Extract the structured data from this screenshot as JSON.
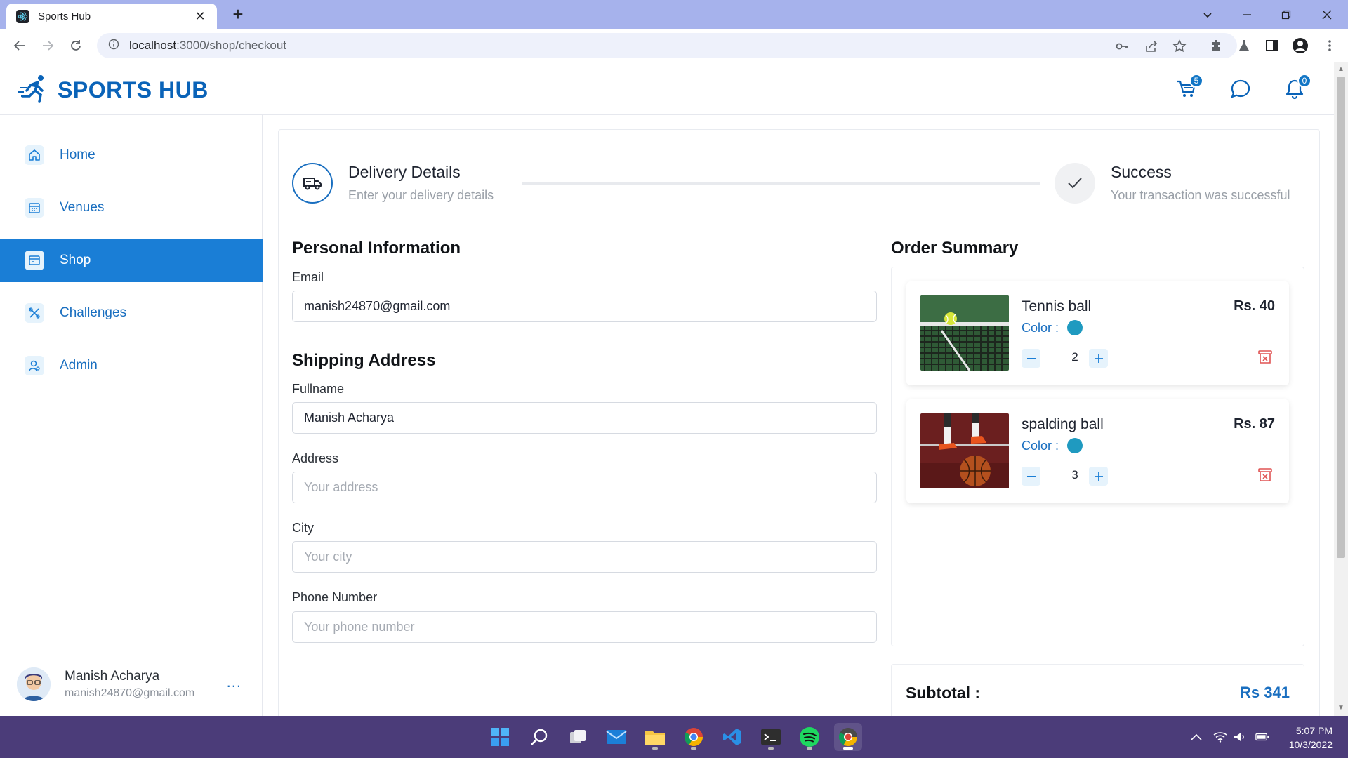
{
  "browser": {
    "tab_title": "Sports Hub",
    "url_host": "localhost",
    "url_path": ":3000/shop/checkout"
  },
  "app": {
    "brand": "SPORTS HUB",
    "cart_count": "5",
    "notification_count": "0"
  },
  "sidebar": {
    "items": [
      {
        "label": "Home",
        "icon": "home-icon"
      },
      {
        "label": "Venues",
        "icon": "calendar-icon"
      },
      {
        "label": "Shop",
        "icon": "card-icon",
        "active": true
      },
      {
        "label": "Challenges",
        "icon": "tools-icon"
      },
      {
        "label": "Admin",
        "icon": "user-icon"
      }
    ],
    "user": {
      "name": "Manish Acharya",
      "email": "manish24870@gmail.com",
      "more": "..."
    }
  },
  "steps": [
    {
      "title": "Delivery Details",
      "subtitle": "Enter your delivery details"
    },
    {
      "title": "Success",
      "subtitle": "Your transaction was successful"
    }
  ],
  "personal": {
    "title": "Personal Information",
    "email_label": "Email",
    "email_value": "manish24870@gmail.com"
  },
  "shipping": {
    "title": "Shipping Address",
    "fullname_label": "Fullname",
    "fullname_value": "Manish Acharya",
    "address_label": "Address",
    "address_placeholder": "Your address",
    "city_label": "City",
    "city_placeholder": "Your city",
    "phone_label": "Phone Number",
    "phone_placeholder": "Your phone number"
  },
  "order": {
    "title": "Order Summary",
    "items": [
      {
        "name": "Tennis ball",
        "price": "Rs. 40",
        "color_label": "Color :",
        "qty": "2",
        "swatch": "#1f9ac0"
      },
      {
        "name": "spalding ball",
        "price": "Rs. 87",
        "color_label": "Color :",
        "qty": "3",
        "swatch": "#1f9ac0"
      }
    ],
    "subtotal_label": "Subtotal :",
    "subtotal_value": "Rs 341"
  },
  "taskbar": {
    "time": "5:07 PM",
    "date": "10/3/2022"
  },
  "colors": {
    "accent": "#1a7ed6",
    "brand": "#0a63b8",
    "taskbar": "#4b3c79",
    "tabstrip": "#a6b2ec"
  }
}
